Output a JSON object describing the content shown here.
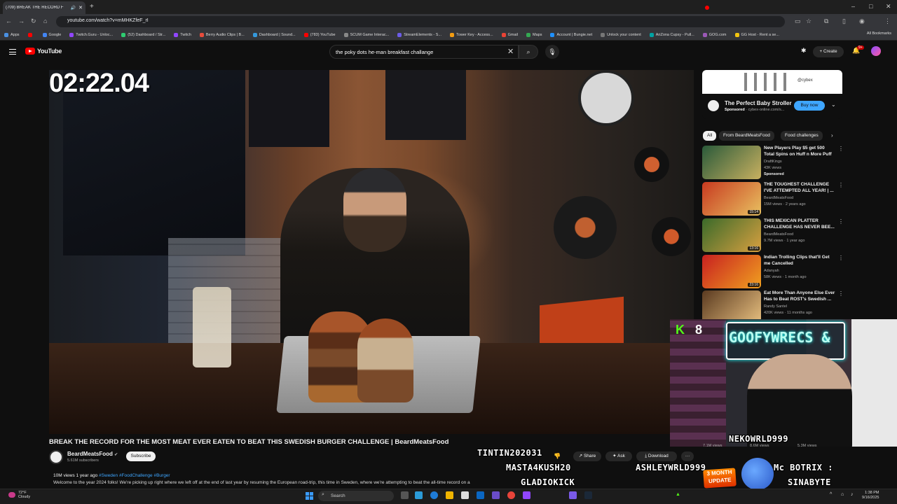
{
  "browser": {
    "tab_title": "(709) BREAK THE RECORD F",
    "new_tab": "+",
    "window_controls": [
      "–",
      "□",
      "✕"
    ],
    "url": "youtube.com/watch?v=mMHKZfeF_rI",
    "bookmarks": [
      {
        "label": "Apps",
        "color": "#4a90e2"
      },
      {
        "label": "",
        "color": "#ff0000"
      },
      {
        "label": "Google",
        "color": "#4285f4"
      },
      {
        "label": "Twitch.Guru - Unloc...",
        "color": "#9146ff"
      },
      {
        "label": "(52) Dashboard / Str...",
        "color": "#2ecc71"
      },
      {
        "label": "Twitch",
        "color": "#9146ff"
      },
      {
        "label": "Berry Audio Clips | B...",
        "color": "#e74c3c"
      },
      {
        "label": "Dashboard | Sound...",
        "color": "#3498db"
      },
      {
        "label": "(783) YouTube",
        "color": "#ff0000"
      },
      {
        "label": "SCUM Game Interac...",
        "color": "#888888"
      },
      {
        "label": "StreamElements - S...",
        "color": "#6c5ce7"
      },
      {
        "label": "Tower Key - Access...",
        "color": "#f39c12"
      },
      {
        "label": "Gmail",
        "color": "#ea4335"
      },
      {
        "label": "Maps",
        "color": "#34a853"
      },
      {
        "label": "Account | Bungie.net",
        "color": "#1e90ff"
      },
      {
        "label": "Unlock your content",
        "color": "#777777"
      },
      {
        "label": "AriZona Cupsy - Pull...",
        "color": "#00a3a3"
      },
      {
        "label": "GOG.com",
        "color": "#9b59b6"
      },
      {
        "label": "GG Host - Rent a se...",
        "color": "#f1c40f"
      }
    ],
    "all_bookmarks": "All Bookmarks"
  },
  "youtube": {
    "logo": "YouTube",
    "search_query": "the poky dots he-man breakfast challange",
    "create": "Create",
    "notification_count": "9+"
  },
  "video": {
    "timer": "02:22.04",
    "title": "BREAK THE RECORD FOR THE MOST MEAT EVER EATEN TO BEAT THIS SWEDISH BURGER CHALLENGE | BeardMeatsFood",
    "channel": "BeardMeatsFood",
    "subscribers": "5.61M subscribers",
    "subscribe": "Subscribe",
    "share": "Share",
    "ask": "Ask",
    "download": "Download",
    "more": "···",
    "views_age": "10M views  1 year ago",
    "tags": "#Sweden #FoodChallenge #Burger",
    "description": "Welcome to the year 2024 folks! We're picking up right where we left off at the end of last year by resuming the European road-trip, this time in Sweden, where we're attempting to beat the all-time record on a"
  },
  "ad": {
    "brand": "@cybex",
    "title": "The Perfect Baby Stroller",
    "sponsored": "Sponsored",
    "domain": "· cybex-online.com/s...",
    "buy": "Buy now"
  },
  "chips": [
    "All",
    "From BeardMeatsFood",
    "Food challenges"
  ],
  "recommended": [
    {
      "title": "New Players Play $5 get 500 Total Spins on Huff n More Puff",
      "channel": "DraftKings",
      "views": "43K views",
      "extra": "Sponsored",
      "duration": "",
      "color1": "#2a5a3a",
      "color2": "#c8b060"
    },
    {
      "title": "THE TOUGHEST CHALLENGE I'VE ATTEMPTED ALL YEAR! | ...",
      "channel": "BeardMeatsFood",
      "views": "15M views · 2 years ago",
      "extra": "",
      "duration": "15:14",
      "color1": "#c83a20",
      "color2": "#e8c060"
    },
    {
      "title": "THIS MEXICAN PLATTER CHALLENGE HAS NEVER BEE...",
      "channel": "BeardMeatsFood",
      "views": "9.7M views · 1 year ago",
      "extra": "",
      "duration": "13:16",
      "color1": "#3a6a2a",
      "color2": "#d8a040"
    },
    {
      "title": "Indian Trolling Clips that'll Get me Cancelled",
      "channel": "Adanyah",
      "views": "58K views · 1 month ago",
      "extra": "",
      "duration": "23:16",
      "color1": "#c82020",
      "color2": "#f0a020"
    },
    {
      "title": "Eat More Than Anyone Else Ever Has to Beat ROST's Swedish ...",
      "channel": "Randy Santel",
      "views": "420K views · 11 months ago",
      "extra": "",
      "duration": "",
      "color1": "#5a3a20",
      "color2": "#e8c080"
    }
  ],
  "stream": {
    "kick_logo": "K",
    "kick_count": "8",
    "neon": "GOOFYWRECS &",
    "alerts": {
      "nekowrld": "NEKOWRLD999",
      "tintin": "TINTIN202031",
      "masta": "MASTA4KUSH20",
      "ashley": "ASHLEYWRLD999",
      "botrix": "Mc BOTRIX :",
      "gladio": "GLADIOKICK",
      "sinabyte": "SINABYTE"
    },
    "views_row": [
      "7.1M views",
      "8.6M views",
      "5.3M views"
    ],
    "month_update": "3 MONTH UPDATE"
  },
  "taskbar": {
    "temp": "72°F",
    "weather": "Cloudy",
    "search": "Search",
    "time": "1:38 PM",
    "date": "9/16/2025"
  }
}
